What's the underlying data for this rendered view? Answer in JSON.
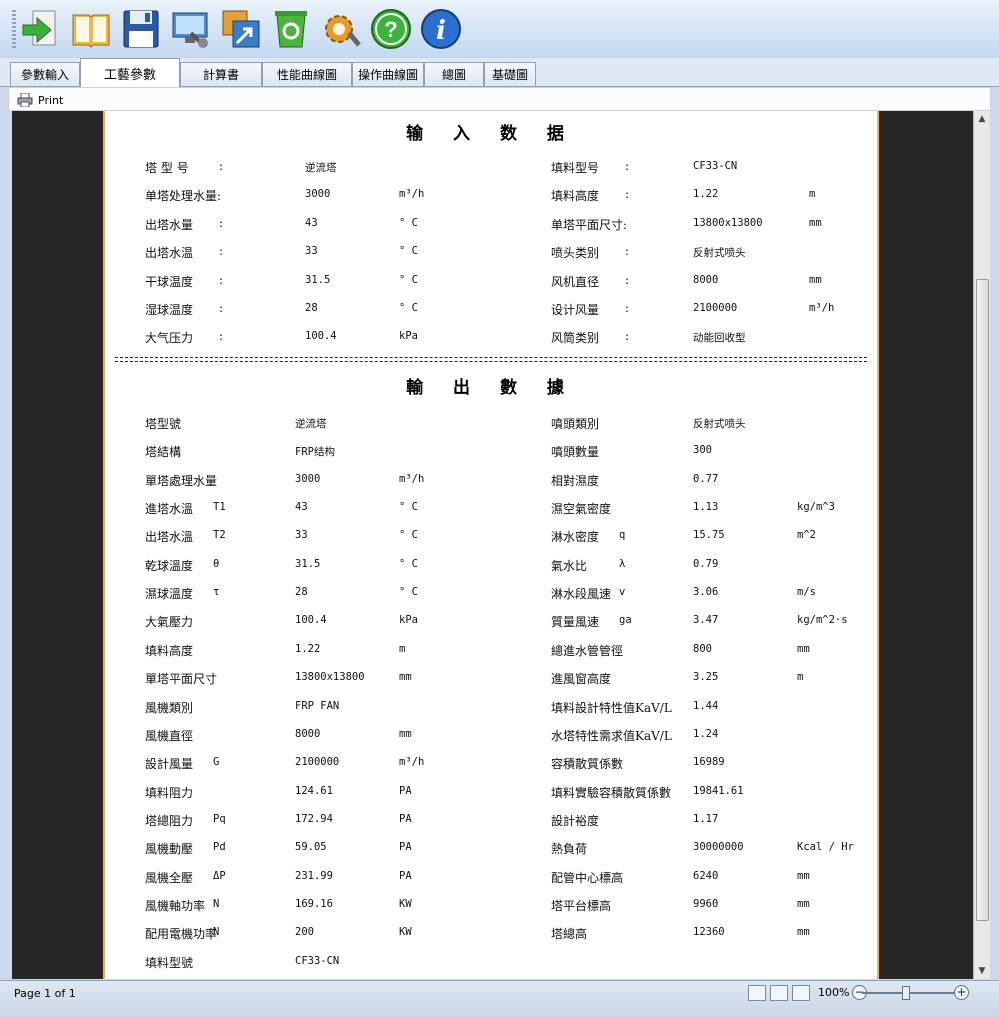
{
  "tabs": [
    "參數輸入",
    "工藝參數",
    "計算書",
    "性能曲線圖",
    "操作曲線圖",
    "總圖",
    "基礎圖"
  ],
  "print_label": "Print",
  "input_title": "输 入 数 据",
  "output_title": "輸 出 數 據",
  "input_rows": [
    {
      "l1": "塔 型 号",
      "c1": ":",
      "v1": "逆流塔",
      "u1": "",
      "l2": "填料型号",
      "c2": ":",
      "v2": "CF33-CN",
      "u2": ""
    },
    {
      "l1": "单塔处理水量:",
      "c1": "",
      "v1": "3000",
      "u1": "m³/h",
      "l2": "填料高度",
      "c2": ":",
      "v2": "1.22",
      "u2": "m"
    },
    {
      "l1": "出塔水量",
      "c1": ":",
      "v1": "43",
      "u1": "° C",
      "l2": "单塔平面尺寸:",
      "c2": "",
      "v2": "13800x13800",
      "u2": "mm"
    },
    {
      "l1": "出塔水温",
      "c1": ":",
      "v1": "33",
      "u1": "° C",
      "l2": "喷头类别",
      "c2": ":",
      "v2": "反射式喷头",
      "u2": ""
    },
    {
      "l1": "干球温度",
      "c1": ":",
      "v1": "31.5",
      "u1": "° C",
      "l2": "风机直径",
      "c2": ":",
      "v2": "8000",
      "u2": "mm"
    },
    {
      "l1": "湿球温度",
      "c1": ":",
      "v1": "28",
      "u1": "° C",
      "l2": "设计风量",
      "c2": ":",
      "v2": "2100000",
      "u2": "m³/h"
    },
    {
      "l1": "大气压力",
      "c1": ":",
      "v1": "100.4",
      "u1": "kPa",
      "l2": "风筒类别",
      "c2": ":",
      "v2": "动能回收型",
      "u2": ""
    }
  ],
  "output_rows": [
    {
      "l1": "塔型號",
      "s1": "",
      "v1": "逆流塔",
      "u1": "",
      "l2": "噴頭類別",
      "s2": "",
      "v2": "反射式喷头",
      "u2": ""
    },
    {
      "l1": "塔結構",
      "s1": "",
      "v1": "FRP结构",
      "u1": "",
      "l2": "噴頭數量",
      "s2": "",
      "v2": "300",
      "u2": ""
    },
    {
      "l1": "單塔處理水量",
      "s1": "",
      "v1": "3000",
      "u1": "m³/h",
      "l2": "相對濕度",
      "s2": "",
      "v2": "0.77",
      "u2": ""
    },
    {
      "l1": "進塔水溫",
      "s1": "T1",
      "v1": "43",
      "u1": "° C",
      "l2": "濕空氣密度",
      "s2": "",
      "v2": "1.13",
      "u2": "kg/m^3"
    },
    {
      "l1": "出塔水溫",
      "s1": "T2",
      "v1": "33",
      "u1": "° C",
      "l2": "淋水密度",
      "s2": "q",
      "v2": "15.75",
      "u2": "m^2"
    },
    {
      "l1": "乾球溫度",
      "s1": "θ",
      "v1": "31.5",
      "u1": "° C",
      "l2": "氣水比",
      "s2": "λ",
      "v2": "0.79",
      "u2": ""
    },
    {
      "l1": "濕球溫度",
      "s1": "τ",
      "v1": "28",
      "u1": "° C",
      "l2": "淋水段風速",
      "s2": "v",
      "v2": "3.06",
      "u2": "m/s"
    },
    {
      "l1": "大氣壓力",
      "s1": "",
      "v1": "100.4",
      "u1": "kPa",
      "l2": "質量風速",
      "s2": "ga",
      "v2": "3.47",
      "u2": "kg/m^2·s"
    },
    {
      "l1": "填料高度",
      "s1": "",
      "v1": "1.22",
      "u1": "m",
      "l2": "總進水管管徑",
      "s2": "",
      "v2": "800",
      "u2": "mm"
    },
    {
      "l1": "單塔平面尺寸",
      "s1": "",
      "v1": "13800x13800",
      "u1": "mm",
      "l2": "進風窗高度",
      "s2": "",
      "v2": "3.25",
      "u2": "m"
    },
    {
      "l1": "風機類別",
      "s1": "",
      "v1": "FRP FAN",
      "u1": "",
      "l2": "填料設計特性值KaV/L",
      "s2": "",
      "v2": "1.44",
      "u2": ""
    },
    {
      "l1": "風機直徑",
      "s1": "",
      "v1": "8000",
      "u1": "mm",
      "l2": "水塔特性需求值KaV/L",
      "s2": "",
      "v2": "1.24",
      "u2": ""
    },
    {
      "l1": "設計風量",
      "s1": "G",
      "v1": "2100000",
      "u1": "m³/h",
      "l2": "容積散質係數",
      "s2": "",
      "v2": "16989",
      "u2": ""
    },
    {
      "l1": "填料阻力",
      "s1": "",
      "v1": "124.61",
      "u1": "PA",
      "l2": "填料實驗容積散質係數",
      "s2": "",
      "v2": "19841.61",
      "u2": ""
    },
    {
      "l1": "塔總阻力",
      "s1": "Pq",
      "v1": "172.94",
      "u1": "PA",
      "l2": "設計裕度",
      "s2": "",
      "v2": "1.17",
      "u2": ""
    },
    {
      "l1": "風機動壓",
      "s1": "Pd",
      "v1": "59.05",
      "u1": "PA",
      "l2": "熱負荷",
      "s2": "",
      "v2": "30000000",
      "u2": "Kcal / Hr"
    },
    {
      "l1": "風機全壓",
      "s1": "ΔP",
      "v1": "231.99",
      "u1": "PA",
      "l2": "配管中心標高",
      "s2": "",
      "v2": "6240",
      "u2": "mm"
    },
    {
      "l1": "風機軸功率",
      "s1": "N",
      "v1": "169.16",
      "u1": "KW",
      "l2": "塔平台標高",
      "s2": "",
      "v2": "9960",
      "u2": "mm"
    },
    {
      "l1": "配用電機功率",
      "s1": "N",
      "v1": "200",
      "u1": "KW",
      "l2": "塔總高",
      "s2": "",
      "v2": "12360",
      "u2": "mm"
    },
    {
      "l1": "填料型號",
      "s1": "",
      "v1": "CF33-CN",
      "u1": "",
      "l2": "",
      "s2": "",
      "v2": "",
      "u2": ""
    }
  ],
  "status": {
    "page_label": "Page 1 of 1",
    "zoom": "100%"
  },
  "icons": [
    "exit-arrow-icon",
    "open-book-icon",
    "save-disk-icon",
    "settings-monitor-icon",
    "export-icon",
    "recycle-bin-icon",
    "gear-icon",
    "help-icon",
    "info-icon"
  ]
}
